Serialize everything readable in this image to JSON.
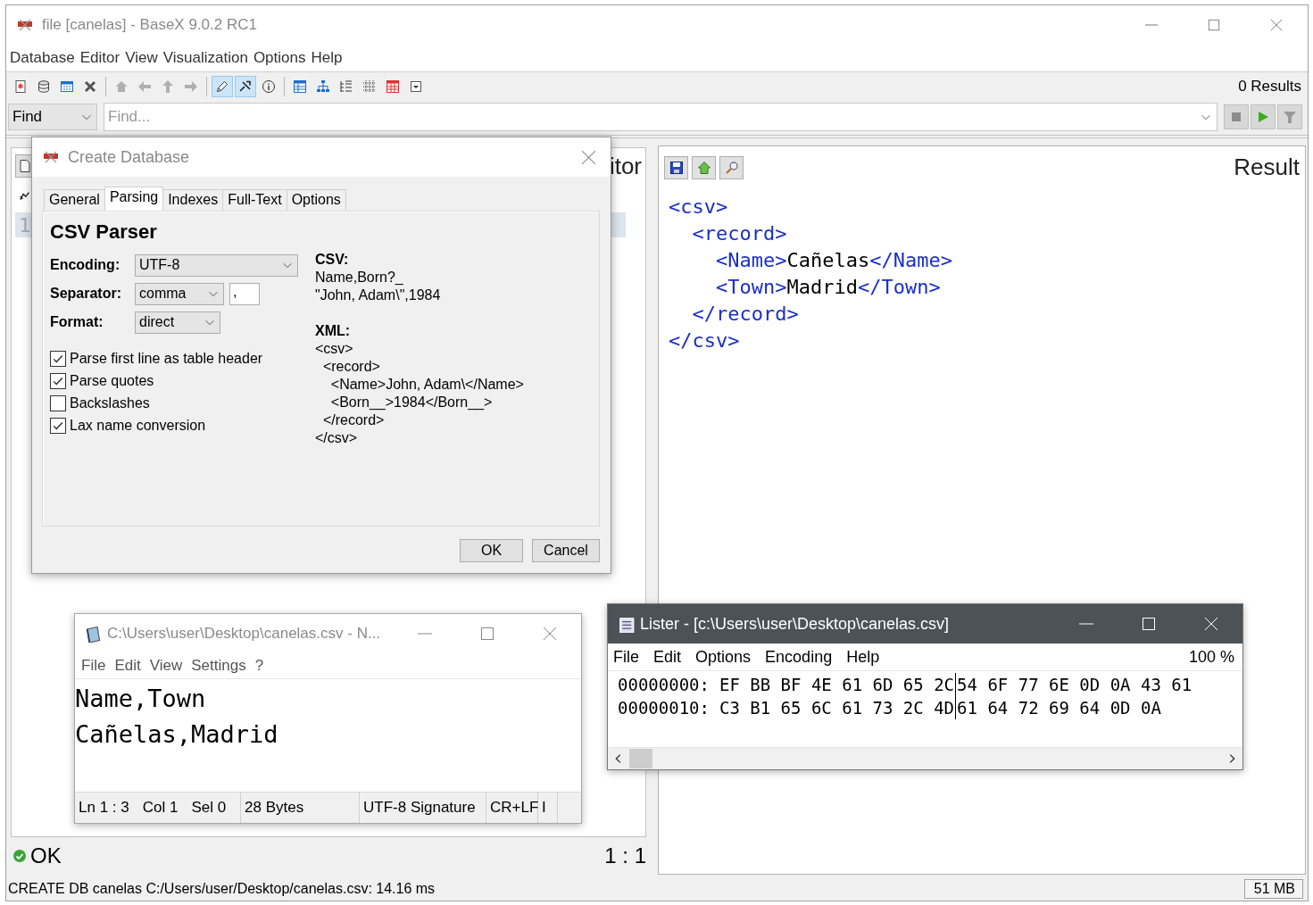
{
  "window": {
    "title": "file [canelas] - BaseX 9.0.2 RC1"
  },
  "menu": [
    {
      "label": "Database"
    },
    {
      "label": "Editor"
    },
    {
      "label": "View"
    },
    {
      "label": "Visualization"
    },
    {
      "label": "Options"
    },
    {
      "label": "Help"
    }
  ],
  "toolbar": {
    "groups": [
      [
        {
          "selected": false,
          "disabled": false
        },
        {
          "selected": false,
          "disabled": false
        },
        {
          "selected": false,
          "disabled": false
        },
        {
          "selected": false,
          "disabled": false
        }
      ],
      [
        {
          "selected": false,
          "disabled": true
        },
        {
          "selected": false,
          "disabled": true
        },
        {
          "selected": false,
          "disabled": true
        },
        {
          "selected": false,
          "disabled": true
        }
      ],
      [
        {
          "selected": true,
          "disabled": false
        },
        {
          "selected": true,
          "disabled": false
        },
        {
          "selected": false,
          "disabled": false
        }
      ],
      [
        {
          "selected": false,
          "disabled": false
        },
        {
          "selected": false,
          "disabled": false
        },
        {
          "selected": false,
          "disabled": false
        },
        {
          "selected": false,
          "disabled": false
        },
        {
          "selected": false,
          "disabled": false
        },
        {
          "selected": false,
          "disabled": false
        }
      ]
    ],
    "results": "0 Results"
  },
  "find": {
    "mode": "Find",
    "placeholder": "Find...",
    "buttons": [
      {
        "disabled": true
      },
      {
        "disabled": false
      },
      {
        "disabled": true
      }
    ]
  },
  "editor": {
    "title": "itor",
    "line_numbers": [
      "1"
    ],
    "status": "OK",
    "position": "1 : 1"
  },
  "result": {
    "title": "Result",
    "lines": [
      [
        {
          "kind": "tag",
          "text": "<csv>"
        }
      ],
      [
        {
          "kind": "tag",
          "text": "  <record>"
        }
      ],
      [
        {
          "kind": "tag",
          "text": "    <Name>"
        },
        {
          "kind": "text",
          "text": "Cañelas"
        },
        {
          "kind": "tag",
          "text": "</Name>"
        }
      ],
      [
        {
          "kind": "tag",
          "text": "    <Town>"
        },
        {
          "kind": "text",
          "text": "Madrid"
        },
        {
          "kind": "tag",
          "text": "</Town>"
        }
      ],
      [
        {
          "kind": "tag",
          "text": "  </record>"
        }
      ],
      [
        {
          "kind": "tag",
          "text": "</csv>"
        }
      ]
    ]
  },
  "status_bar": {
    "message": "CREATE DB canelas C:/Users/user/Desktop/canelas.csv: 14.16 ms",
    "memory": "51 MB"
  },
  "dialog": {
    "title": "Create Database",
    "tabs": [
      {
        "label": "General",
        "selected": false
      },
      {
        "label": "Parsing",
        "selected": true
      },
      {
        "label": "Indexes",
        "selected": false
      },
      {
        "label": "Full-Text",
        "selected": false
      },
      {
        "label": "Options",
        "selected": false
      }
    ],
    "heading": "CSV Parser",
    "fields": [
      {
        "label": "Encoding:",
        "value": "UTF-8"
      },
      {
        "label": "Separator:",
        "value": "comma",
        "extra": ","
      },
      {
        "label": "Format:",
        "value": "direct"
      }
    ],
    "options": [
      {
        "label": "Parse first line as table header",
        "checked": true
      },
      {
        "label": "Parse quotes",
        "checked": true
      },
      {
        "label": "Backslashes",
        "checked": false
      },
      {
        "label": "Lax name conversion",
        "checked": true
      }
    ],
    "csv_preview": {
      "heading": "CSV:",
      "lines": [
        "Name,Born?_",
        "\"John, Adam\\\",1984"
      ]
    },
    "xml_preview": {
      "heading": "XML:",
      "lines": [
        "<csv>",
        "  <record>",
        "    <Name>John, Adam\\</Name>",
        "    <Born__>1984</Born__>",
        "  </record>",
        "</csv>"
      ]
    },
    "buttons": [
      {
        "label": "OK"
      },
      {
        "label": "Cancel"
      }
    ]
  },
  "notepad": {
    "title": "C:\\Users\\user\\Desktop\\canelas.csv - N...",
    "menu": [
      {
        "label": "File"
      },
      {
        "label": "Edit"
      },
      {
        "label": "View"
      },
      {
        "label": "Settings"
      },
      {
        "label": "?"
      }
    ],
    "lines": [
      "Name,Town",
      "Cañelas,Madrid"
    ],
    "status": [
      [
        "Ln 1 : 3",
        "Col 1",
        "Sel 0"
      ],
      [
        "28 Bytes"
      ],
      [
        "UTF-8 Signature"
      ],
      [
        "CR+LF"
      ],
      [
        "I"
      ]
    ]
  },
  "lister": {
    "title": "Lister - [c:\\Users\\user\\Desktop\\canelas.csv]",
    "menu": [
      {
        "label": "File"
      },
      {
        "label": "Edit"
      },
      {
        "label": "Options"
      },
      {
        "label": "Encoding"
      },
      {
        "label": "Help"
      }
    ],
    "zoom": {
      "label": "100 %"
    },
    "rows": [
      {
        "offset": "00000000:",
        "left": "EF BB BF 4E 61 6D 65 2C",
        "right": "54 6F 77 6E 0D 0A 43 61"
      },
      {
        "offset": "00000010:",
        "left": "C3 B1 65 6C 61 73 2C 4D",
        "right": "61 64 72 69 64 0D 0A"
      }
    ]
  }
}
